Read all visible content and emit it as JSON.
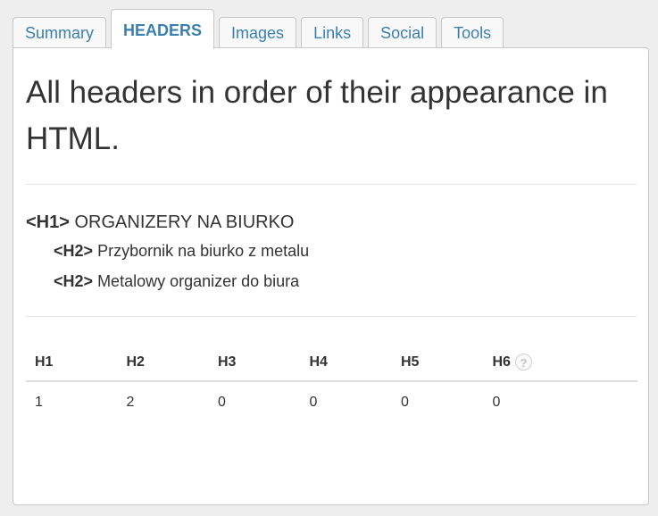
{
  "tabs": [
    {
      "label": "Summary",
      "active": false
    },
    {
      "label": "HEADERS",
      "active": true
    },
    {
      "label": "Images",
      "active": false
    },
    {
      "label": "Links",
      "active": false
    },
    {
      "label": "Social",
      "active": false
    },
    {
      "label": "Tools",
      "active": false
    }
  ],
  "title": "All headers in order of their appearance in HTML.",
  "headers": [
    {
      "tag": "<H1>",
      "text": "ORGANIZERY NA BIURKO"
    },
    {
      "tag": "<H2>",
      "text": "Przybornik na biurko z metalu"
    },
    {
      "tag": "<H2>",
      "text": "Metalowy organizer do biura"
    }
  ],
  "stats": {
    "columns": [
      "H1",
      "H2",
      "H3",
      "H4",
      "H5",
      "H6"
    ],
    "values": [
      "1",
      "2",
      "0",
      "0",
      "0",
      "0"
    ],
    "help_glyph": "?"
  },
  "colors": {
    "tab_text": "#3a7fae",
    "border": "#c8c8c8",
    "background": "#eeeeee"
  }
}
